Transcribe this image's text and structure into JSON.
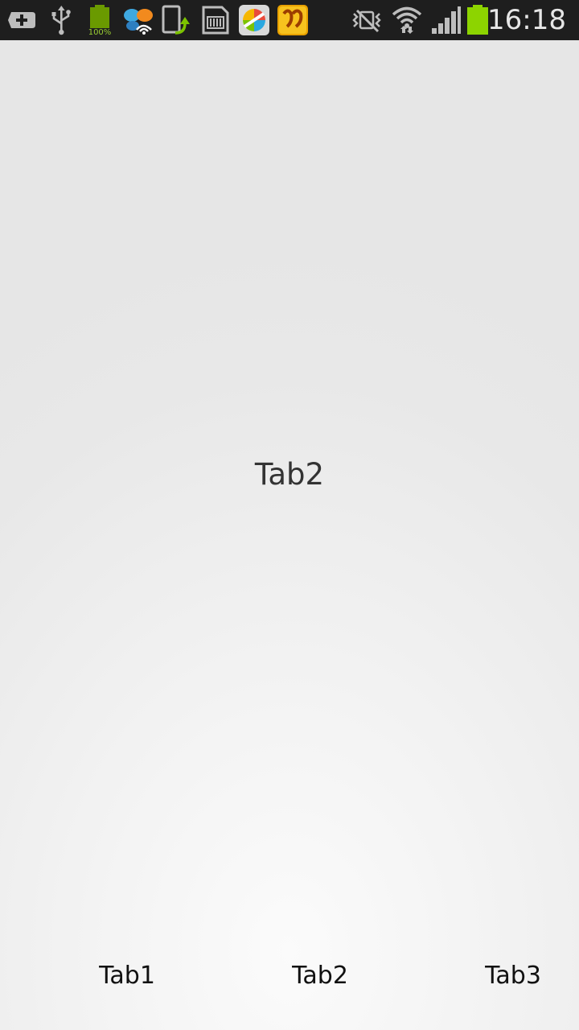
{
  "status_bar": {
    "time": "16:18",
    "battery_small_label": "100%",
    "icons": [
      "add-notification-icon",
      "usb-icon",
      "battery-full-notification-icon",
      "wifi-butterfly-app-icon",
      "phone-update-icon",
      "sd-card-icon",
      "colorful-app-icon",
      "orange-app-icon",
      "vibrate-mute-icon",
      "wifi-icon",
      "cell-signal-icon",
      "battery-icon"
    ],
    "colors": {
      "background": "#1e1e1e",
      "battery_green": "#8dd400"
    }
  },
  "main": {
    "label": "Tab2"
  },
  "tabs": [
    {
      "label": "Tab1"
    },
    {
      "label": "Tab2"
    },
    {
      "label": "Tab3"
    }
  ]
}
